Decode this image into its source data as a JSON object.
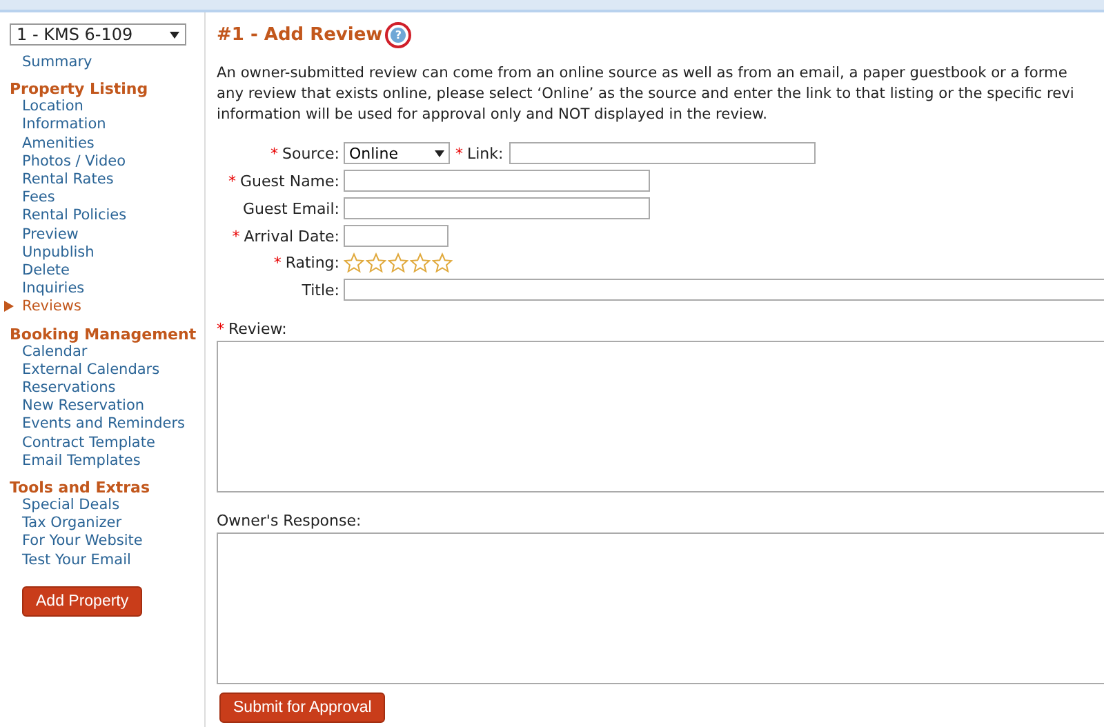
{
  "property_select": {
    "value": "1 - KMS 6-109"
  },
  "sidebar": {
    "summary": {
      "label": "Summary",
      "selected": false
    },
    "groups": [
      {
        "title": "Property Listing",
        "items": [
          {
            "label": "Location",
            "selected": false
          },
          {
            "label": "Information",
            "selected": false
          },
          {
            "label": "Amenities",
            "selected": false
          },
          {
            "label": "Photos / Video",
            "selected": false
          },
          {
            "label": "Rental Rates",
            "selected": false
          },
          {
            "label": "Fees",
            "selected": false
          },
          {
            "label": "Rental Policies",
            "selected": false
          },
          {
            "label": "Preview",
            "selected": false
          },
          {
            "label": "Unpublish",
            "selected": false
          },
          {
            "label": "Delete",
            "selected": false
          },
          {
            "label": "Inquiries",
            "selected": false
          },
          {
            "label": "Reviews",
            "selected": true
          }
        ]
      },
      {
        "title": "Booking Management",
        "items": [
          {
            "label": "Calendar",
            "selected": false
          },
          {
            "label": "External Calendars",
            "selected": false
          },
          {
            "label": "Reservations",
            "selected": false
          },
          {
            "label": "New Reservation",
            "selected": false
          },
          {
            "label": "Events and Reminders",
            "selected": false
          },
          {
            "label": "Contract Template",
            "selected": false
          },
          {
            "label": "Email Templates",
            "selected": false
          }
        ]
      },
      {
        "title": "Tools and Extras",
        "items": [
          {
            "label": "Special Deals",
            "selected": false
          },
          {
            "label": "Tax Organizer",
            "selected": false
          },
          {
            "label": "For Your Website",
            "selected": false
          },
          {
            "label": "Test Your Email",
            "selected": false
          }
        ]
      }
    ],
    "add_button": "Add Property"
  },
  "page_title": "#1 - Add Review",
  "help_icon": "?",
  "description": [
    "An owner-submitted review can come from an online source as well as from an email, a paper guestbook or a forme",
    "any review that exists online, please select ‘Online’ as the source and enter the link to that listing or the specific revi",
    "information will be used for approval only and NOT displayed in the review."
  ],
  "form": {
    "required_mark": "*",
    "source": {
      "label": "Source:",
      "value": "Online",
      "required": true
    },
    "link": {
      "label": "Link:",
      "required": true
    },
    "fields": [
      {
        "label": "Guest Name:",
        "required": true,
        "kind": "wide"
      },
      {
        "label": "Guest Email:",
        "required": false,
        "kind": "wide"
      },
      {
        "label": "Arrival Date:",
        "required": true,
        "kind": "short"
      },
      {
        "label": "Rating:",
        "required": true,
        "kind": "stars",
        "stars": 0
      },
      {
        "label": "Title:",
        "required": false,
        "kind": "full"
      }
    ],
    "review": {
      "label": "Review:",
      "required": true
    },
    "response": {
      "label": "Owner's Response:",
      "required": false
    },
    "submit": "Submit for Approval"
  }
}
